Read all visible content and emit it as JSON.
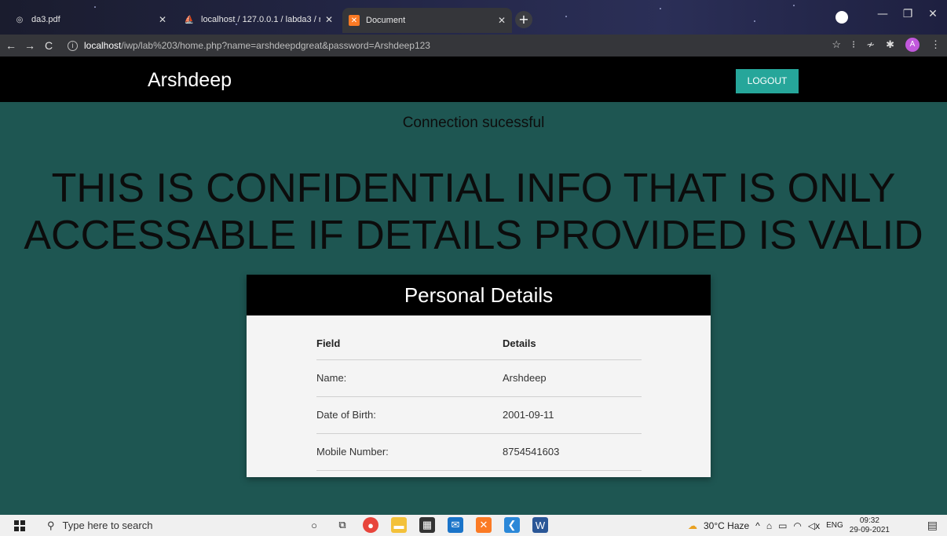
{
  "browser": {
    "tabs": [
      {
        "title": "da3.pdf",
        "icon": "globe-icon"
      },
      {
        "title": "localhost / 127.0.0.1 / labda3 / re",
        "icon": "phpmyadmin-icon"
      },
      {
        "title": "Document",
        "icon": "xampp-icon",
        "active": true
      }
    ],
    "url_host": "localhost",
    "url_path": "/iwp/lab%203/home.php?name=arshdeepdgreat&password=Arshdeep123",
    "profile_initial": "A"
  },
  "page": {
    "brand": "Arshdeep",
    "logout_label": "LOGOUT",
    "connection_message": "Connection sucessful",
    "headline_line1": "THIS IS CONFIDENTIAL INFO THAT IS ONLY",
    "headline_line2": "ACCESSABLE IF DETAILS PROVIDED IS VALID",
    "card_title": "Personal Details",
    "table": {
      "headers": [
        "Field",
        "Details"
      ],
      "rows": [
        [
          "Name:",
          "Arshdeep"
        ],
        [
          "Date of Birth:",
          "2001-09-11"
        ],
        [
          "Mobile Number:",
          "8754541603"
        ]
      ]
    },
    "colors": {
      "background": "#1e5652",
      "accent": "#26a69a",
      "nav": "#000000"
    }
  },
  "taskbar": {
    "search_placeholder": "Type here to search",
    "weather": "30°C  Haze",
    "language": "ENG",
    "time": "09:32",
    "date": "29-09-2021"
  }
}
